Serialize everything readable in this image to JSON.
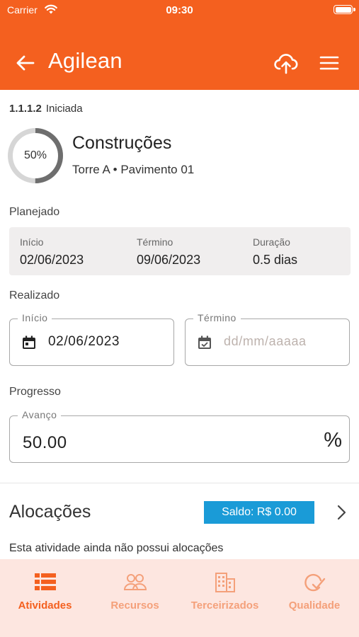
{
  "status_bar": {
    "carrier": "Carrier",
    "time": "09:30"
  },
  "header": {
    "brand": "Agilean",
    "back_icon": "arrow-left-icon",
    "upload_icon": "cloud-upload-icon",
    "menu_icon": "hamburger-menu-icon"
  },
  "activity": {
    "code": "1.1.1.2",
    "status": "Iniciada",
    "progress_label": "50%",
    "progress_value": 0.5,
    "title": "Construções",
    "subtitle": "Torre A • Pavimento 01"
  },
  "planned": {
    "section_label": "Planejado",
    "start_label": "Início",
    "start_value": "02/06/2023",
    "end_label": "Término",
    "end_value": "09/06/2023",
    "duration_label": "Duração",
    "duration_value": "0.5 dias"
  },
  "realized": {
    "section_label": "Realizado",
    "start_label": "Início",
    "start_value": "02/06/2023",
    "end_label": "Término",
    "end_placeholder": "dd/mm/aaaaa"
  },
  "progress": {
    "section_label": "Progresso",
    "field_label": "Avanço",
    "value": "50.00",
    "unit": "%"
  },
  "allocations": {
    "title": "Alocações",
    "balance": "Saldo: R$ 0.00",
    "empty_message": "Esta atividade ainda não possui alocações"
  },
  "tabs": [
    {
      "label": "Atividades",
      "icon": "list-icon",
      "active": true
    },
    {
      "label": "Recursos",
      "icon": "people-icon",
      "active": false
    },
    {
      "label": "Terceirizados",
      "icon": "building-icon",
      "active": false
    },
    {
      "label": "Qualidade",
      "icon": "quality-check-icon",
      "active": false
    }
  ],
  "colors": {
    "brand": "#f4601f",
    "tab_bar": "#fde6e0",
    "balance_badge": "#1a9bd7",
    "tab_inactive": "#f4a07a"
  }
}
